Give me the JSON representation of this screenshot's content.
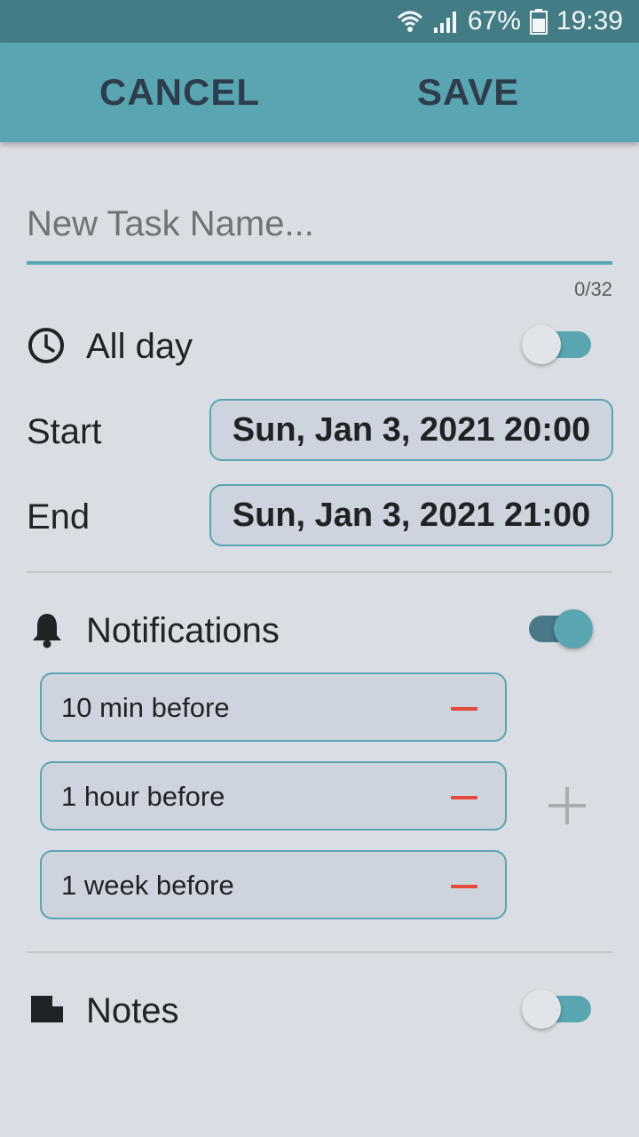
{
  "status_bar": {
    "battery": "67%",
    "time": "19:39",
    "icons": [
      "wifi-icon",
      "signal-icon",
      "battery-icon"
    ]
  },
  "app_bar": {
    "cancel_label": "CANCEL",
    "save_label": "SAVE"
  },
  "task": {
    "placeholder": "New Task Name...",
    "value": "",
    "counter": "0/32"
  },
  "all_day": {
    "label": "All day",
    "icon": "clock-icon",
    "enabled": false
  },
  "start": {
    "label": "Start",
    "value": "Sun, Jan 3, 2021 20:00"
  },
  "end": {
    "label": "End",
    "value": "Sun, Jan 3, 2021 21:00"
  },
  "notifications": {
    "label": "Notifications",
    "icon": "bell-icon",
    "enabled": true,
    "items": [
      {
        "label": "10 min before"
      },
      {
        "label": "1 hour before"
      },
      {
        "label": "1 week before"
      }
    ]
  },
  "notes": {
    "label": "Notes",
    "icon": "note-icon",
    "enabled": false
  },
  "colors": {
    "accent": "#5aa5b2",
    "app_bar": "#5aa5b2",
    "status_bar": "#437c85",
    "remove": "#e54a3c",
    "background": "#dadde3"
  }
}
